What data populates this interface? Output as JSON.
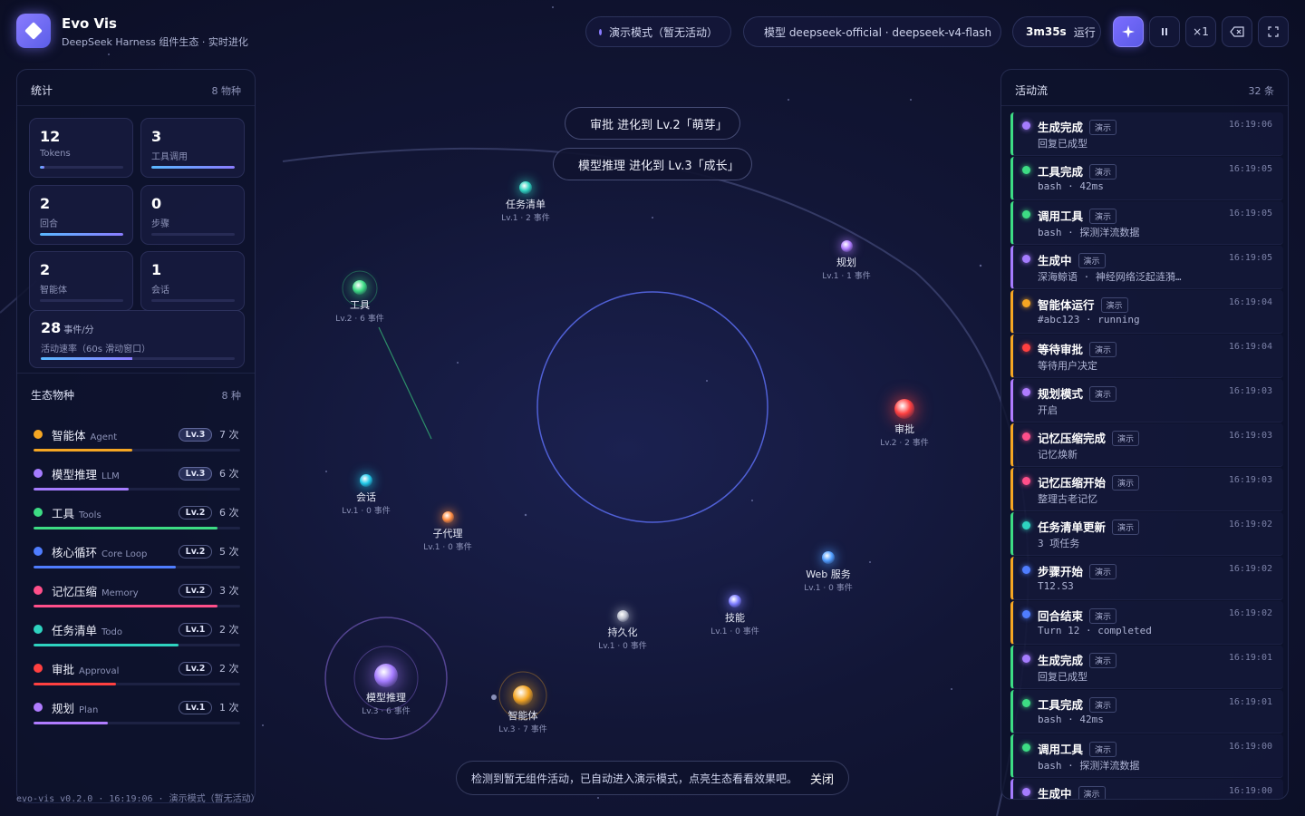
{
  "app": {
    "title": "Evo Vis",
    "subtitle": "DeepSeek Harness 组件生态 · 实时进化"
  },
  "header": {
    "mode_pill": "演示模式（暂无活动）",
    "model_pill": "模型 deepseek-official · deepseek-v4-flash",
    "runtime": "3m35s",
    "runtime_state": "运行",
    "speed": "×1",
    "colors": {
      "mode_dot": "#8a7cff",
      "model_dot": "#3ddc84"
    }
  },
  "stats": {
    "title": "统计",
    "species_count": "8 物种",
    "cards": [
      {
        "value": "12",
        "label": "Tokens",
        "fill": 0.05
      },
      {
        "value": "3",
        "label": "工具调用",
        "fill": 1.0
      },
      {
        "value": "2",
        "label": "回合",
        "fill": 1.0
      },
      {
        "value": "0",
        "label": "步骤",
        "fill": 0.0
      },
      {
        "value": "2",
        "label": "智能体",
        "fill": 0.0
      },
      {
        "value": "1",
        "label": "会话",
        "fill": 0.0
      }
    ],
    "rate": {
      "value": "28",
      "unit": "事件/分",
      "label": "活动速率（60s 滑动窗口）",
      "fill": 0.47
    }
  },
  "ecology": {
    "title": "生态物种",
    "count": "8 种",
    "items": [
      {
        "name": "智能体",
        "en": "Agent",
        "level": "Lv.3",
        "count": "7 次",
        "color": "#f5a623",
        "fill": 0.48
      },
      {
        "name": "模型推理",
        "en": "LLM",
        "level": "Lv.3",
        "count": "6 次",
        "color": "#a57cff",
        "fill": 0.46
      },
      {
        "name": "工具",
        "en": "Tools",
        "level": "Lv.2",
        "count": "6 次",
        "color": "#3ddc84",
        "fill": 0.89
      },
      {
        "name": "核心循环",
        "en": "Core Loop",
        "level": "Lv.2",
        "count": "5 次",
        "color": "#4f7dff",
        "fill": 0.69
      },
      {
        "name": "记忆压缩",
        "en": "Memory",
        "level": "Lv.2",
        "count": "3 次",
        "color": "#ff4f8a",
        "fill": 0.89
      },
      {
        "name": "任务清单",
        "en": "Todo",
        "level": "Lv.1",
        "count": "2 次",
        "color": "#2ed3c0",
        "fill": 0.7
      },
      {
        "name": "审批",
        "en": "Approval",
        "level": "Lv.2",
        "count": "2 次",
        "color": "#ff4040",
        "fill": 0.4
      },
      {
        "name": "规划",
        "en": "Plan",
        "level": "Lv.1",
        "count": "1 次",
        "color": "#b07cff",
        "fill": 0.36
      }
    ]
  },
  "footer": {
    "version": "evo-vis v0.2.0",
    "time": "16:19:06",
    "mode": "演示模式（暂无活动）"
  },
  "nodes": [
    {
      "name": "任务清单",
      "sub": "Lv.1 · 2 事件",
      "color": "#2ed3c0"
    },
    {
      "name": "规划",
      "sub": "Lv.1 · 1 事件",
      "color": "#b07cff"
    },
    {
      "name": "工具",
      "sub": "Lv.2 · 6 事件",
      "color": "#3ddc84"
    },
    {
      "name": "审批",
      "sub": "Lv.2 · 2 事件",
      "color": "#ff4040"
    },
    {
      "name": "会话",
      "sub": "Lv.1 · 0 事件",
      "color": "#1fc8e8"
    },
    {
      "name": "子代理",
      "sub": "Lv.1 · 0 事件",
      "color": "#ff8a3d"
    },
    {
      "name": "Web 服务",
      "sub": "Lv.1 · 0 事件",
      "color": "#4f9dff"
    },
    {
      "name": "技能",
      "sub": "Lv.1 · 0 事件",
      "color": "#7c7cff"
    },
    {
      "name": "持久化",
      "sub": "Lv.1 · 0 事件",
      "color": "#b8bccc"
    },
    {
      "name": "模型推理",
      "sub": "Lv.3 · 6 事件",
      "color": "#a57cff"
    },
    {
      "name": "智能体",
      "sub": "Lv.3 · 7 事件",
      "color": "#f5a623"
    }
  ],
  "toasts": [
    {
      "text": "审批 进化到 Lv.2「萌芽」",
      "color": "#ff4040"
    },
    {
      "text": "模型推理 进化到 Lv.3「成长」",
      "color": "#a57cff"
    }
  ],
  "banner": {
    "text": "检测到暂无组件活动，已自动进入演示模式，点亮生态看看效果吧。",
    "close": "关闭"
  },
  "activity": {
    "title": "活动流",
    "count": "32 条",
    "tag": "演示",
    "items": [
      {
        "title": "生成完成",
        "desc": "回复已成型",
        "time": "16:19:06",
        "color": "#a57cff",
        "border": "#3ddc84"
      },
      {
        "title": "工具完成",
        "desc": "bash · 42ms",
        "time": "16:19:05",
        "color": "#3ddc84",
        "border": "#3ddc84"
      },
      {
        "title": "调用工具",
        "desc": "bash · 探测洋流数据",
        "time": "16:19:05",
        "color": "#3ddc84",
        "border": "#3ddc84"
      },
      {
        "title": "生成中",
        "desc": "深海鲸语 · 神经网络泛起涟漪…",
        "time": "16:19:05",
        "color": "#a57cff",
        "border": "#a57cff"
      },
      {
        "title": "智能体运行",
        "desc": "#abc123 · running",
        "time": "16:19:04",
        "color": "#f5a623",
        "border": "#f5a623"
      },
      {
        "title": "等待审批",
        "desc": "等待用户决定",
        "time": "16:19:04",
        "color": "#ff4040",
        "border": "#f5a623"
      },
      {
        "title": "规划模式",
        "desc": "开启",
        "time": "16:19:03",
        "color": "#b07cff",
        "border": "#b07cff"
      },
      {
        "title": "记忆压缩完成",
        "desc": "记忆焕新",
        "time": "16:19:03",
        "color": "#ff4f8a",
        "border": "#f5a623"
      },
      {
        "title": "记忆压缩开始",
        "desc": "整理古老记忆",
        "time": "16:19:03",
        "color": "#ff4f8a",
        "border": "#f5a623"
      },
      {
        "title": "任务清单更新",
        "desc": "3 项任务",
        "time": "16:19:02",
        "color": "#2ed3c0",
        "border": "#3ddc84"
      },
      {
        "title": "步骤开始",
        "desc": "T12.S3",
        "time": "16:19:02",
        "color": "#4f7dff",
        "border": "#f5a623"
      },
      {
        "title": "回合结束",
        "desc": "Turn 12 · completed",
        "time": "16:19:02",
        "color": "#4f7dff",
        "border": "#f5a623"
      },
      {
        "title": "生成完成",
        "desc": "回复已成型",
        "time": "16:19:01",
        "color": "#a57cff",
        "border": "#3ddc84"
      },
      {
        "title": "工具完成",
        "desc": "bash · 42ms",
        "time": "16:19:01",
        "color": "#3ddc84",
        "border": "#3ddc84"
      },
      {
        "title": "调用工具",
        "desc": "bash · 探测洋流数据",
        "time": "16:19:00",
        "color": "#3ddc84",
        "border": "#3ddc84"
      },
      {
        "title": "生成中",
        "desc": "",
        "time": "16:19:00",
        "color": "#a57cff",
        "border": "#a57cff"
      }
    ]
  }
}
